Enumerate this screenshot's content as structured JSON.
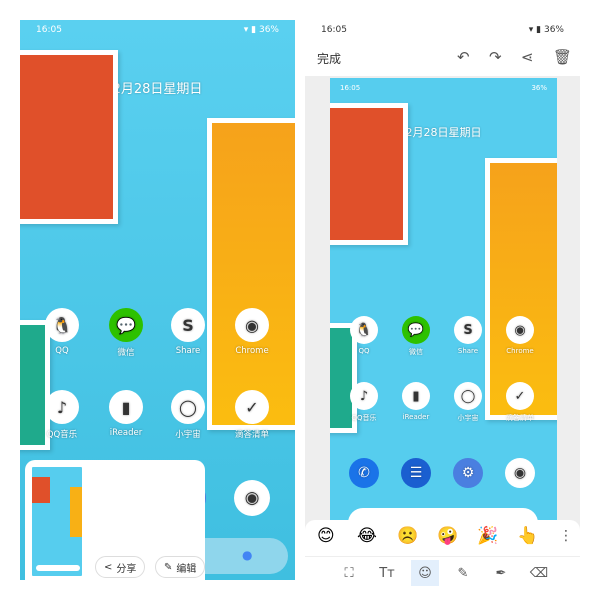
{
  "status": {
    "time": "16:05",
    "battery": "36%"
  },
  "home": {
    "date": "2月28日星期日",
    "apps": [
      {
        "label": "QQ",
        "icon": "qq-icon",
        "glyph": "🐧",
        "bg": "#ffffff"
      },
      {
        "label": "微信",
        "icon": "wechat-icon",
        "glyph": "💬",
        "bg": "#2dc100"
      },
      {
        "label": "Share",
        "icon": "share-app-icon",
        "glyph": "S",
        "bg": "#ffffff"
      },
      {
        "label": "Chrome",
        "icon": "chrome-icon",
        "glyph": "◉",
        "bg": "#ffffff"
      },
      {
        "label": "QQ音乐",
        "icon": "qq-music-icon",
        "glyph": "♪",
        "bg": "#ffffff"
      },
      {
        "label": "iReader",
        "icon": "ireader-icon",
        "glyph": "▮",
        "bg": "#ffffff"
      },
      {
        "label": "小宇宙",
        "icon": "xiaoyuzhou-icon",
        "glyph": "◯",
        "bg": "#ffffff"
      },
      {
        "label": "滴答清单",
        "icon": "ticktick-icon",
        "glyph": "✓",
        "bg": "#ffffff"
      }
    ],
    "dock": [
      {
        "icon": "phone-icon",
        "glyph": "✆",
        "bg": "#1a73e8"
      },
      {
        "icon": "messages-icon",
        "glyph": "☰",
        "bg": "#1a5fd0"
      },
      {
        "icon": "settings-icon",
        "glyph": "⚙",
        "bg": "#4a7fe0"
      },
      {
        "icon": "camera-icon",
        "glyph": "◉",
        "bg": "#ffffff"
      }
    ]
  },
  "screenshot_actions": {
    "share": "分享",
    "edit": "编辑"
  },
  "editor": {
    "done": "完成",
    "emojis": [
      "😊",
      "😂",
      "☹️",
      "🤪",
      "🎉",
      "👆"
    ],
    "tools": [
      {
        "icon": "crop-icon",
        "glyph": "⛶"
      },
      {
        "icon": "text-icon",
        "glyph": "Tт"
      },
      {
        "icon": "sticker-icon",
        "glyph": "☺"
      },
      {
        "icon": "marker-icon",
        "glyph": "✎"
      },
      {
        "icon": "pen-icon",
        "glyph": "✒"
      },
      {
        "icon": "eraser-icon",
        "glyph": "⌫"
      }
    ],
    "active_tool": "sticker-icon",
    "accent": "#e3effc"
  }
}
